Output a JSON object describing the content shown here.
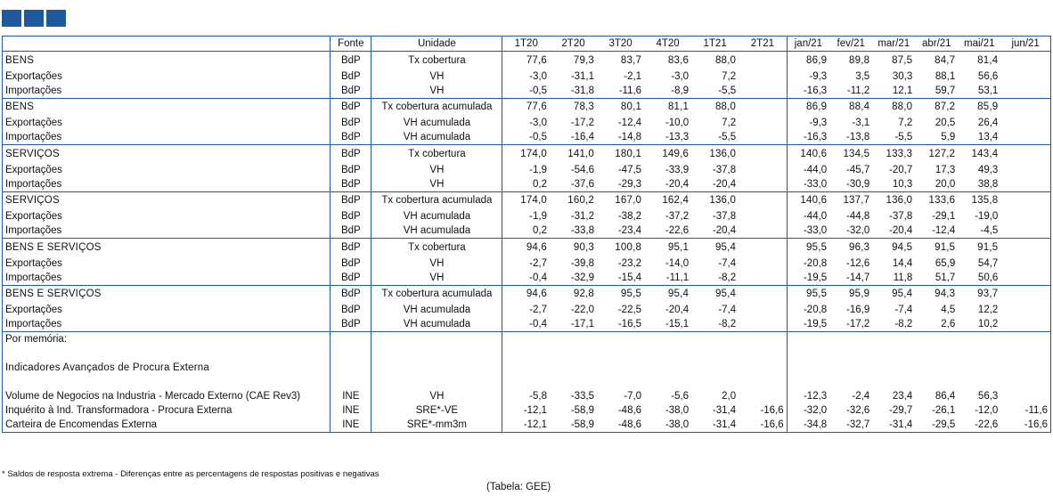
{
  "header": {
    "label": "",
    "fonte": "Fonte",
    "unidade": "Unidade",
    "quarters": [
      "1T20",
      "2T20",
      "3T20",
      "4T20",
      "1T21",
      "2T21"
    ],
    "months": [
      "jan/21",
      "fev/21",
      "mar/21",
      "abr/21",
      "mai/21",
      "jun/21"
    ]
  },
  "groups": [
    {
      "rows": [
        {
          "label": "BENS",
          "bold": true,
          "fonte": "BdP",
          "unidade": "Tx cobertura",
          "q": [
            "77,6",
            "79,3",
            "83,7",
            "83,6",
            "88,0",
            ""
          ],
          "m": [
            "86,9",
            "89,8",
            "87,5",
            "84,7",
            "81,4",
            ""
          ]
        },
        {
          "label": "Exportações",
          "fonte": "BdP",
          "unidade": "VH",
          "q": [
            "-3,0",
            "-31,1",
            "-2,1",
            "-3,0",
            "7,2",
            ""
          ],
          "m": [
            "-9,3",
            "3,5",
            "30,3",
            "88,1",
            "56,6",
            ""
          ]
        },
        {
          "label": "Importações",
          "fonte": "BdP",
          "unidade": "VH",
          "q": [
            "-0,5",
            "-31,8",
            "-11,6",
            "-8,9",
            "-5,5",
            ""
          ],
          "m": [
            "-16,3",
            "-11,2",
            "12,1",
            "59,7",
            "53,1",
            ""
          ]
        },
        {
          "label": "BENS",
          "bold": true,
          "fonte": "BdP",
          "unidade": "Tx cobertura acumulada",
          "q": [
            "77,6",
            "78,3",
            "80,1",
            "81,1",
            "88,0",
            ""
          ],
          "m": [
            "86,9",
            "88,4",
            "88,0",
            "87,2",
            "85,9",
            ""
          ]
        },
        {
          "label": "Exportações",
          "fonte": "BdP",
          "unidade": "VH acumulada",
          "q": [
            "-3,0",
            "-17,2",
            "-12,4",
            "-10,0",
            "7,2",
            ""
          ],
          "m": [
            "-9,3",
            "-3,1",
            "7,2",
            "20,5",
            "26,4",
            ""
          ]
        },
        {
          "label": "Importações",
          "fonte": "BdP",
          "unidade": "VH acumulada",
          "q": [
            "-0,5",
            "-16,4",
            "-14,8",
            "-13,3",
            "-5,5",
            ""
          ],
          "m": [
            "-16,3",
            "-13,8",
            "-5,5",
            "5,9",
            "13,4",
            ""
          ]
        }
      ]
    },
    {
      "rows": [
        {
          "label": "SERVIÇOS",
          "bold": true,
          "fonte": "BdP",
          "unidade": "Tx cobertura",
          "q": [
            "174,0",
            "141,0",
            "180,1",
            "149,6",
            "136,0",
            ""
          ],
          "m": [
            "140,6",
            "134,5",
            "133,3",
            "127,2",
            "143,4",
            ""
          ]
        },
        {
          "label": "Exportações",
          "fonte": "BdP",
          "unidade": "VH",
          "q": [
            "-1,9",
            "-54,6",
            "-47,5",
            "-33,9",
            "-37,8",
            ""
          ],
          "m": [
            "-44,0",
            "-45,7",
            "-20,7",
            "17,3",
            "49,3",
            ""
          ]
        },
        {
          "label": "Importações",
          "fonte": "BdP",
          "unidade": "VH",
          "q": [
            "0,2",
            "-37,6",
            "-29,3",
            "-20,4",
            "-20,4",
            ""
          ],
          "m": [
            "-33,0",
            "-30,9",
            "10,3",
            "20,0",
            "38,8",
            ""
          ]
        },
        {
          "label": "SERVIÇOS",
          "bold": true,
          "fonte": "BdP",
          "unidade": "Tx cobertura acumulada",
          "q": [
            "174,0",
            "160,2",
            "167,0",
            "162,4",
            "136,0",
            ""
          ],
          "m": [
            "140,6",
            "137,7",
            "136,0",
            "133,6",
            "135,8",
            ""
          ]
        },
        {
          "label": "Exportações",
          "fonte": "BdP",
          "unidade": "VH acumulada",
          "q": [
            "-1,9",
            "-31,2",
            "-38,2",
            "-37,2",
            "-37,8",
            ""
          ],
          "m": [
            "-44,0",
            "-44,8",
            "-37,8",
            "-29,1",
            "-19,0",
            ""
          ]
        },
        {
          "label": "Importações",
          "fonte": "BdP",
          "unidade": "VH acumulada",
          "q": [
            "0,2",
            "-33,8",
            "-23,4",
            "-22,6",
            "-20,4",
            ""
          ],
          "m": [
            "-33,0",
            "-32,0",
            "-20,4",
            "-12,4",
            "-4,5",
            ""
          ]
        }
      ]
    },
    {
      "rows": [
        {
          "label": "BENS E SERVIÇOS",
          "bold": true,
          "fonte": "BdP",
          "unidade": "Tx cobertura",
          "q": [
            "94,6",
            "90,3",
            "100,8",
            "95,1",
            "95,4",
            ""
          ],
          "m": [
            "95,5",
            "96,3",
            "94,5",
            "91,5",
            "91,5",
            ""
          ]
        },
        {
          "label": "Exportações",
          "fonte": "BdP",
          "unidade": "VH",
          "q": [
            "-2,7",
            "-39,8",
            "-23,2",
            "-14,0",
            "-7,4",
            ""
          ],
          "m": [
            "-20,8",
            "-12,6",
            "14,4",
            "65,9",
            "54,7",
            ""
          ]
        },
        {
          "label": "Importações",
          "fonte": "BdP",
          "unidade": "VH",
          "q": [
            "-0,4",
            "-32,9",
            "-15,4",
            "-11,1",
            "-8,2",
            ""
          ],
          "m": [
            "-19,5",
            "-14,7",
            "11,8",
            "51,7",
            "50,6",
            ""
          ]
        },
        {
          "label": "BENS E SERVIÇOS",
          "bold": true,
          "fonte": "BdP",
          "unidade": "Tx cobertura acumulada",
          "q": [
            "94,6",
            "92,8",
            "95,5",
            "95,4",
            "95,4",
            ""
          ],
          "m": [
            "95,5",
            "95,9",
            "95,4",
            "94,3",
            "93,7",
            ""
          ]
        },
        {
          "label": "Exportações",
          "fonte": "BdP",
          "unidade": "VH acumulada",
          "q": [
            "-2,7",
            "-22,0",
            "-22,5",
            "-20,4",
            "-7,4",
            ""
          ],
          "m": [
            "-20,8",
            "-16,9",
            "-7,4",
            "4,5",
            "12,2",
            ""
          ]
        },
        {
          "label": "Importações",
          "fonte": "BdP",
          "unidade": "VH acumulada",
          "q": [
            "-0,4",
            "-17,1",
            "-16,5",
            "-15,1",
            "-8,2",
            ""
          ],
          "m": [
            "-19,5",
            "-17,2",
            "-8,2",
            "2,6",
            "10,2",
            ""
          ]
        }
      ]
    }
  ],
  "memoria": {
    "label": "Por memória:",
    "title": "Indicadores Avançados de Procura Externa",
    "rows": [
      {
        "label": "Volume de Negocios na Industria - Mercado Externo (CAE Rev3)",
        "fonte": "INE",
        "unidade": "VH",
        "q": [
          "-5,8",
          "-33,5",
          "-7,0",
          "-5,6",
          "2,0",
          ""
        ],
        "m": [
          "-12,3",
          "-2,4",
          "23,4",
          "86,4",
          "56,3",
          ""
        ]
      },
      {
        "label": "Inquérito à Ind. Transformadora - Procura Externa",
        "fonte": "INE",
        "unidade": "SRE*-VE",
        "q": [
          "-12,1",
          "-58,9",
          "-48,6",
          "-38,0",
          "-31,4",
          "-16,6"
        ],
        "m": [
          "-32,0",
          "-32,6",
          "-29,7",
          "-26,1",
          "-12,0",
          "-11,6"
        ]
      },
      {
        "label": "Carteira de Encomendas Externa",
        "fonte": "INE",
        "unidade": "SRE*-mm3m",
        "q": [
          "-12,1",
          "-58,9",
          "-48,6",
          "-38,0",
          "-31,4",
          "-16,6"
        ],
        "m": [
          "-34,8",
          "-32,7",
          "-31,4",
          "-29,5",
          "-22,6",
          "-16,6"
        ]
      }
    ]
  },
  "footnote": "* Saldos de resposta extrema - Diferenças entre as percentagens de respostas positivas e negativas",
  "source": "(Tabela: GEE)"
}
